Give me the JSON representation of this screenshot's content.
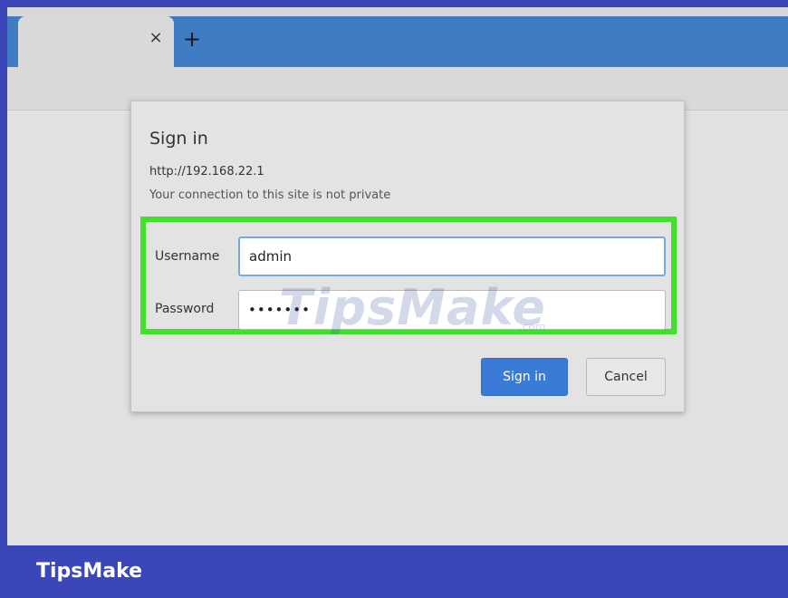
{
  "browser": {
    "tab_close_glyph": "×",
    "new_tab_glyph": "+"
  },
  "dialog": {
    "title": "Sign in",
    "url": "http://192.168.22.1",
    "warning": "Your connection to this site is not private",
    "username_label": "Username",
    "username_value": "admin",
    "password_label": "Password",
    "password_value": "•••••••",
    "signin_button": "Sign in",
    "cancel_button": "Cancel",
    "highlight_color": "#3fe12b",
    "signin_color": "#3a7bd5"
  },
  "watermark": {
    "text": "TipsMake",
    "suffix": ".com"
  },
  "brand": {
    "name": "TipsMake",
    "bar_color": "#3b47b8"
  }
}
